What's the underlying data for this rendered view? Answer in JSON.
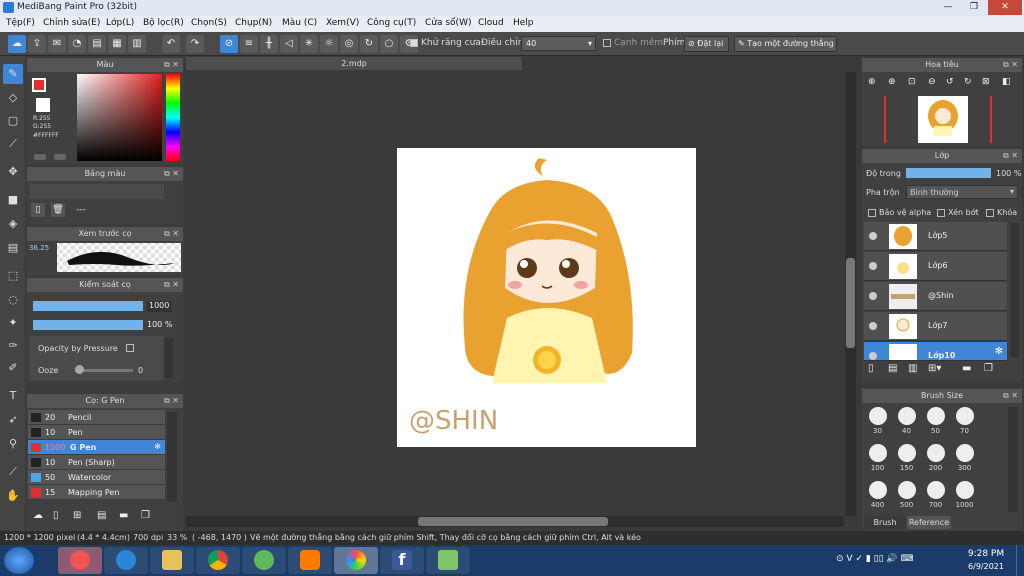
{
  "window": {
    "title": "MediBang Paint Pro (32bit)",
    "min": "—",
    "max": "❐",
    "close": "✕"
  },
  "menu": [
    "Tệp(F)",
    "Chỉnh sửa(E)",
    "Lớp(L)",
    "Bộ lọc(R)",
    "Chọn(S)",
    "Chụp(N)",
    "Màu (C)",
    "Xem(V)",
    "Công cụ(T)",
    "Cửa sổ(W)",
    "Cloud",
    "Help"
  ],
  "toolbar": {
    "antialias_label": "Khử răng cưa",
    "adjust_label": "Điều chỉnh",
    "adjust_value": "40",
    "soften_label": "Cạnh mềm",
    "key_label": "Phím",
    "reset_label": "Đặt lại",
    "make_line_label": "Tạo một đường thẳng"
  },
  "color_panel": {
    "title": "Màu",
    "r": "R:255",
    "g": "G:255",
    "hex": "#FFFFFF",
    "accent": "#e03030"
  },
  "palette_panel": {
    "title": "Bảng màu",
    "value": "---"
  },
  "brush_preview_panel": {
    "title": "Xem trước cọ",
    "size": "36.25"
  },
  "brush_control_panel": {
    "title": "Kiểm soát cọ",
    "size_value": "1000",
    "opacity_value": "100 %",
    "opacity_pressure_label": "Opacity by Pressure",
    "ooze_label": "Ooze",
    "ooze_value": "0"
  },
  "brush_list_panel": {
    "title": "Cọ: G Pen",
    "items": [
      {
        "size": "20",
        "name": "Pencil",
        "color": "#222222"
      },
      {
        "size": "10",
        "name": "Pen",
        "color": "#222222"
      },
      {
        "size": "1000",
        "name": "G Pen",
        "color": "#e03030"
      },
      {
        "size": "10",
        "name": "Pen (Sharp)",
        "color": "#222222"
      },
      {
        "size": "50",
        "name": "Watercolor",
        "color": "#4aa8e8"
      },
      {
        "size": "15",
        "name": "Mapping Pen",
        "color": "#e03030"
      }
    ]
  },
  "document": {
    "tab": "2.mdp",
    "watermark": "@SHIN"
  },
  "navigator_panel": {
    "title": "Hoa tiêu"
  },
  "layer_panel": {
    "title": "Lớp",
    "opacity_label": "Độ trong",
    "opacity_value": "100 %",
    "blend_label": "Pha trộn",
    "blend_value": "Bình thường",
    "protect_alpha_label": "Bảo vệ alpha",
    "clip_label": "Xén bớt",
    "lock_label": "Khóa",
    "layers": [
      {
        "name": "Lớp5"
      },
      {
        "name": "Lớp6"
      },
      {
        "name": "@Shin"
      },
      {
        "name": "Lớp7"
      },
      {
        "name": "Lớp10"
      }
    ]
  },
  "brush_size_panel": {
    "title": "Brush Size",
    "sizes": [
      "30",
      "40",
      "50",
      "70",
      "100",
      "150",
      "200",
      "300",
      "400",
      "500",
      "700",
      "1000"
    ],
    "tab_active": "Brush Size",
    "tab_other": "Reference"
  },
  "status": {
    "dims": "1200 * 1200 pixel",
    "physical": "(4.4 * 4.4cm)",
    "dpi": "700 dpi",
    "zoom": "33 %",
    "coords": "( -468, 1470 )",
    "hint": "Vẽ một đường thẳng bằng cách giữ phím Shift, Thay đổi cỡ cọ bằng cách giữ phím Ctrl, Alt và kéo"
  },
  "taskbar": {
    "time": "9:28 PM",
    "date": "6/9/2021"
  }
}
